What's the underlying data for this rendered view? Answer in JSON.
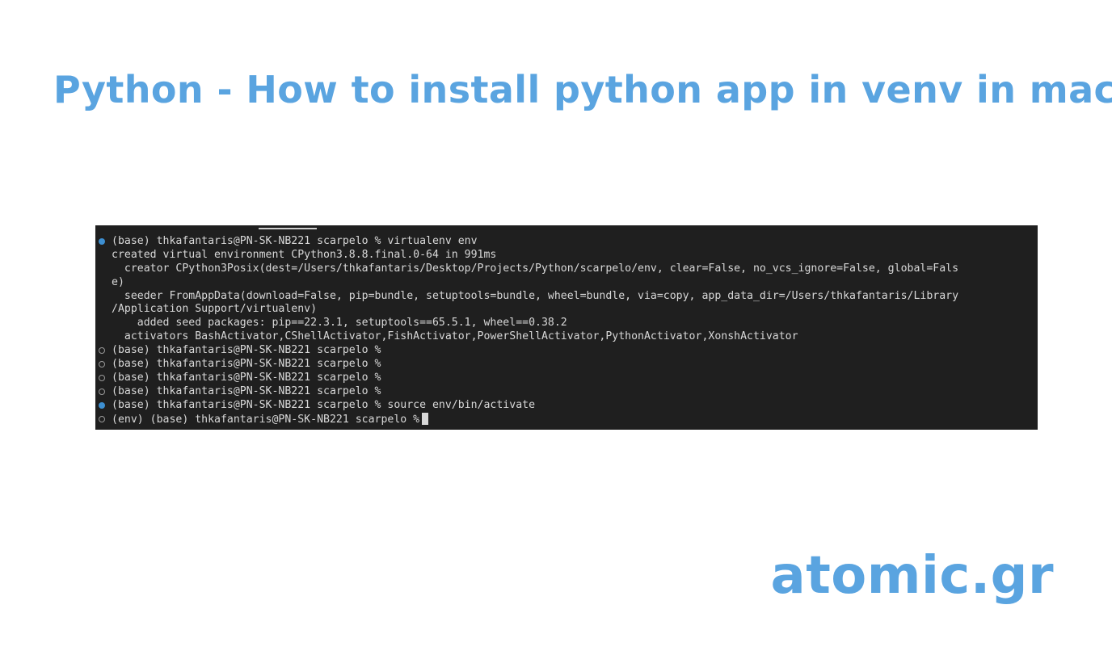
{
  "page": {
    "title": "Python - How to install python app in venv in mac",
    "brand": "atomic.gr",
    "accent_color": "#5aa4e0"
  },
  "terminal": {
    "background_color": "#1f1f1f",
    "lines": [
      {
        "marker": "filled",
        "text": "(base) thkafantaris@PN-SK-NB221 scarpelo % virtualenv env"
      },
      {
        "marker": "none",
        "text": "created virtual environment CPython3.8.8.final.0-64 in 991ms"
      },
      {
        "marker": "none",
        "text": "  creator CPython3Posix(dest=/Users/thkafantaris/Desktop/Projects/Python/scarpelo/env, clear=False, no_vcs_ignore=False, global=Fals"
      },
      {
        "marker": "none",
        "text": "e)"
      },
      {
        "marker": "none",
        "text": "  seeder FromAppData(download=False, pip=bundle, setuptools=bundle, wheel=bundle, via=copy, app_data_dir=/Users/thkafantaris/Library"
      },
      {
        "marker": "none",
        "text": "/Application Support/virtualenv)"
      },
      {
        "marker": "none",
        "text": "    added seed packages: pip==22.3.1, setuptools==65.5.1, wheel==0.38.2"
      },
      {
        "marker": "none",
        "text": "  activators BashActivator,CShellActivator,FishActivator,PowerShellActivator,PythonActivator,XonshActivator"
      },
      {
        "marker": "hollow",
        "text": "(base) thkafantaris@PN-SK-NB221 scarpelo %"
      },
      {
        "marker": "hollow",
        "text": "(base) thkafantaris@PN-SK-NB221 scarpelo %"
      },
      {
        "marker": "hollow",
        "text": "(base) thkafantaris@PN-SK-NB221 scarpelo %"
      },
      {
        "marker": "hollow",
        "text": "(base) thkafantaris@PN-SK-NB221 scarpelo %"
      },
      {
        "marker": "filled",
        "text": "(base) thkafantaris@PN-SK-NB221 scarpelo % source env/bin/activate"
      },
      {
        "marker": "hollow",
        "text": "(env) (base) thkafantaris@PN-SK-NB221 scarpelo %",
        "cursor": true
      }
    ]
  }
}
